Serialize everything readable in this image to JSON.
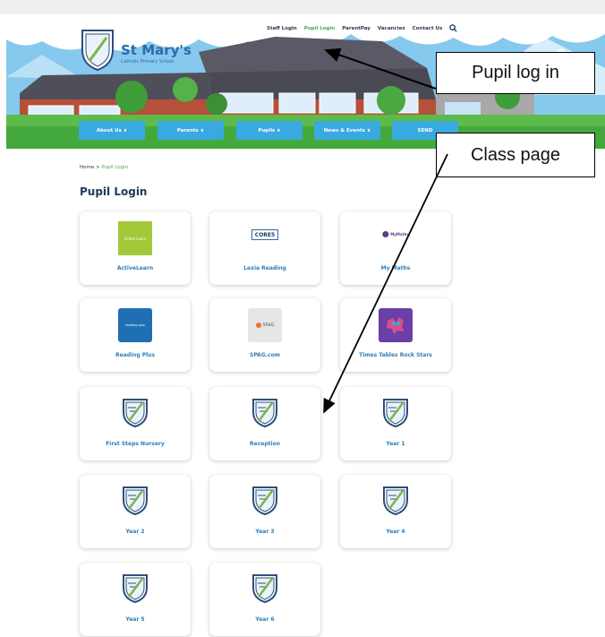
{
  "header": {
    "school_name": "St Mary's",
    "school_subtitle": "Catholic Primary School",
    "top_links": [
      "Staff Login",
      "Pupil Login",
      "ParentPay",
      "Vacancies",
      "Contact Us"
    ],
    "active_top_link": "Pupil Login"
  },
  "nav": {
    "items": [
      {
        "label": "About Us ∨"
      },
      {
        "label": "Parents ∨"
      },
      {
        "label": "Pupils ∨"
      },
      {
        "label": "News & Events ∨"
      },
      {
        "label": "SEND"
      }
    ],
    "color": "#39a9e0"
  },
  "annotations": {
    "pupil_login": "Pupil log in",
    "class_page": "Class page"
  },
  "breadcrumb": {
    "home": "Home",
    "separator": " > ",
    "current": "Pupil Login"
  },
  "page_title": "Pupil Login",
  "cards": [
    {
      "label": "ActiveLearn",
      "thumb_text": "Active Learn",
      "icon": "activelearn-logo"
    },
    {
      "label": "Lexia Reading",
      "thumb_text": "CORE5",
      "icon": "lexia-core5-logo"
    },
    {
      "label": "My Maths",
      "thumb_text": "MyMaths",
      "icon": "mymaths-logo"
    },
    {
      "label": "Reading Plus",
      "thumb_text": "reading plus",
      "icon": "reading-plus-logo"
    },
    {
      "label": "SPAG.com",
      "thumb_text": "SPaG",
      "icon": "spag-logo"
    },
    {
      "label": "Times Tables Rock Stars",
      "thumb_text": "",
      "icon": "ttrockstars-logo"
    },
    {
      "label": "First Steps Nursery",
      "icon": "school-crest-icon"
    },
    {
      "label": "Reception",
      "icon": "school-crest-icon"
    },
    {
      "label": "Year 1",
      "icon": "school-crest-icon"
    },
    {
      "label": "Year 2",
      "icon": "school-crest-icon"
    },
    {
      "label": "Year 3",
      "icon": "school-crest-icon"
    },
    {
      "label": "Year 4",
      "icon": "school-crest-icon"
    },
    {
      "label": "Year 5",
      "icon": "school-crest-icon"
    },
    {
      "label": "Year 6",
      "icon": "school-crest-icon"
    }
  ]
}
